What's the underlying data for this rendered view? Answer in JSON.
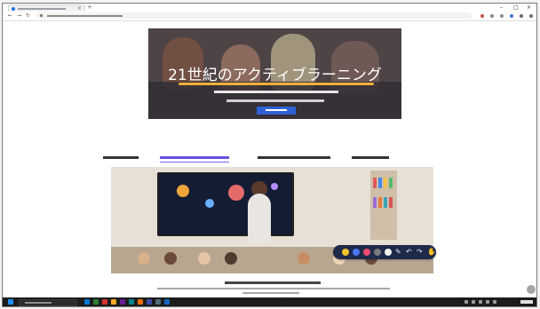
{
  "hero": {
    "title": "21世紀のアクティブラーニング"
  },
  "colors": {
    "hero_underline": "#f3b13a",
    "tab_accent": "#7d5df5",
    "button_blue": "#2f62d6",
    "toolbar_bg": "#1e2a4a",
    "taskbar_bg": "#1c1c1c"
  },
  "annotation_toolbar": {
    "colors": [
      "#f2c62a",
      "#4a78ff",
      "#ef4b6f",
      "#7a7a7a",
      "#f1f1f1"
    ],
    "icons": [
      "pen-icon",
      "undo-icon",
      "redo-icon",
      "hand-icon"
    ]
  },
  "icons": {
    "browser_controls": [
      "back-icon",
      "forward-icon",
      "reload-icon"
    ],
    "window_controls": [
      "minimize-icon",
      "maximize-icon",
      "close-icon"
    ]
  }
}
